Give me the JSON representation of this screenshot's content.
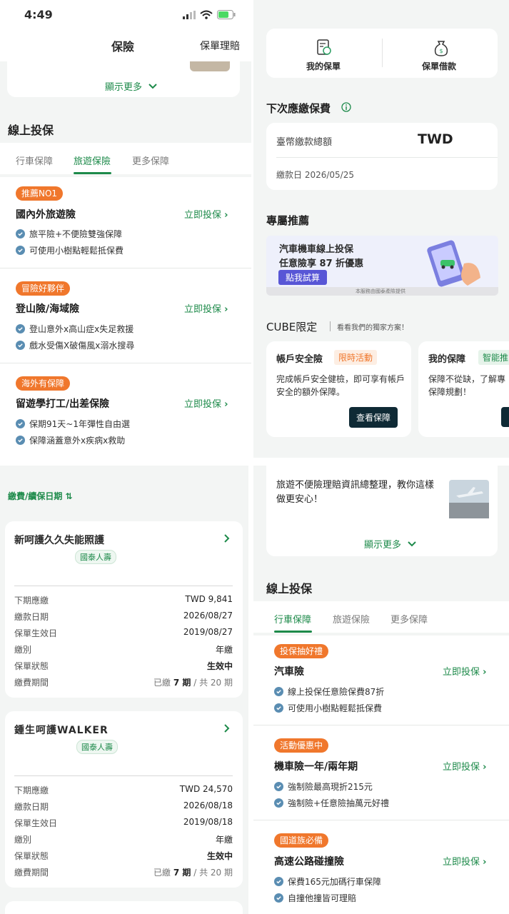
{
  "status": {
    "time": "4:49"
  },
  "q1": {
    "header_title": "保險",
    "header_right": "保單理賠",
    "show_more": "顯示更多",
    "section_title": "線上投保",
    "tabs": [
      "行車保障",
      "旅遊保險",
      "更多保障"
    ],
    "products": [
      {
        "tag": "推薦NO1",
        "title": "國內外旅遊險",
        "action": "立即投保",
        "bullets": [
          "旅平險+不便險雙強保障",
          "可使用小樹點輕鬆抵保費"
        ]
      },
      {
        "tag": "冒險好夥伴",
        "title": "登山險/海域險",
        "action": "立即投保",
        "bullets": [
          "登山意外x高山症x失足救援",
          "戲水受傷X破傷風x溺水搜尋"
        ]
      },
      {
        "tag": "海外有保障",
        "title": "留遊學打工/出差保險",
        "action": "立即投保",
        "bullets": [
          "保期91天~1年彈性自由選",
          "保障涵蓋意外x疾病x救助"
        ]
      }
    ]
  },
  "q2": {
    "quick_actions": [
      "我的保單",
      "保單借款"
    ],
    "next_due_title": "下次應繳保費",
    "total_label": "臺幣繳款總額",
    "total_value": "TWD",
    "due_date": "繳款日 2026/05/25",
    "exclusive_title": "專屬推薦",
    "banner_line1": "汽車機車線上投保",
    "banner_line2": "任意險享 87 折優惠",
    "banner_button": "點我試算",
    "banner_note": "本服務由國泰產險提供",
    "cube_title": "CUBE限定",
    "cube_sub": "看看我們的獨家方案！",
    "cube_cards": [
      {
        "title": "帳戶安全險",
        "badge": "限時活動",
        "desc": "完成帳戶安全健檢，即可享有帳戶安全的額外保障。",
        "button": "查看保障"
      },
      {
        "title": "我的保障",
        "badge": "智能推",
        "desc": "保障不從缺，了解專保障規劃！"
      }
    ]
  },
  "q3": {
    "sort_label": "繳費/續保日期 ⇅",
    "policies": [
      {
        "name": "新呵護久久失能照護",
        "company": "國泰人壽",
        "rows": [
          [
            "下期應繳",
            "TWD 9,841"
          ],
          [
            "繳款日期",
            "2026/08/27"
          ],
          [
            "保單生效日",
            "2019/08/27"
          ],
          [
            "繳別",
            "年繳"
          ],
          [
            "保單狀態",
            "生效中"
          ]
        ],
        "period_label": "繳費期間",
        "period_prefix": "已繳",
        "period_paid": "7 期",
        "period_total": "/ 共 20 期"
      },
      {
        "name": "鍾生呵護WALKER",
        "company": "國泰人壽",
        "rows": [
          [
            "下期應繳",
            "TWD 24,570"
          ],
          [
            "繳款日期",
            "2026/08/18"
          ],
          [
            "保單生效日",
            "2019/08/18"
          ],
          [
            "繳別",
            "年繳"
          ],
          [
            "保單狀態",
            "生效中"
          ]
        ],
        "period_label": "繳費期間",
        "period_prefix": "已繳",
        "period_paid": "7 期",
        "period_total": "/ 共 20 期"
      }
    ]
  },
  "q4": {
    "article": "旅遊不便險理賠資訊總整理，教你這樣做更安心！",
    "show_more": "顯示更多",
    "section_title": "線上投保",
    "tabs": [
      "行車保障",
      "旅遊保險",
      "更多保障"
    ],
    "products": [
      {
        "tag": "投保抽好禮",
        "title": "汽車險",
        "action": "立即投保",
        "bullets": [
          "線上投保任意險保費87折",
          "可使用小樹點輕鬆抵保費"
        ]
      },
      {
        "tag": "活動優惠中",
        "title": "機車險一年/兩年期",
        "action": "立即投保",
        "bullets": [
          "強制險最高現折215元",
          "強制險+任意險抽萬元好禮"
        ]
      },
      {
        "tag": "國道族必備",
        "title": "高速公路碰撞險",
        "action": "立即投保",
        "bullets": [
          "保費165元加碼行車保障",
          "自撞他撞皆可理賠"
        ]
      }
    ]
  },
  "colors": {
    "brand_green": "#1d8a4a",
    "tag_orange": "#f0772c",
    "check_blue": "#5a8db2",
    "dark_button": "#0f2a35"
  }
}
